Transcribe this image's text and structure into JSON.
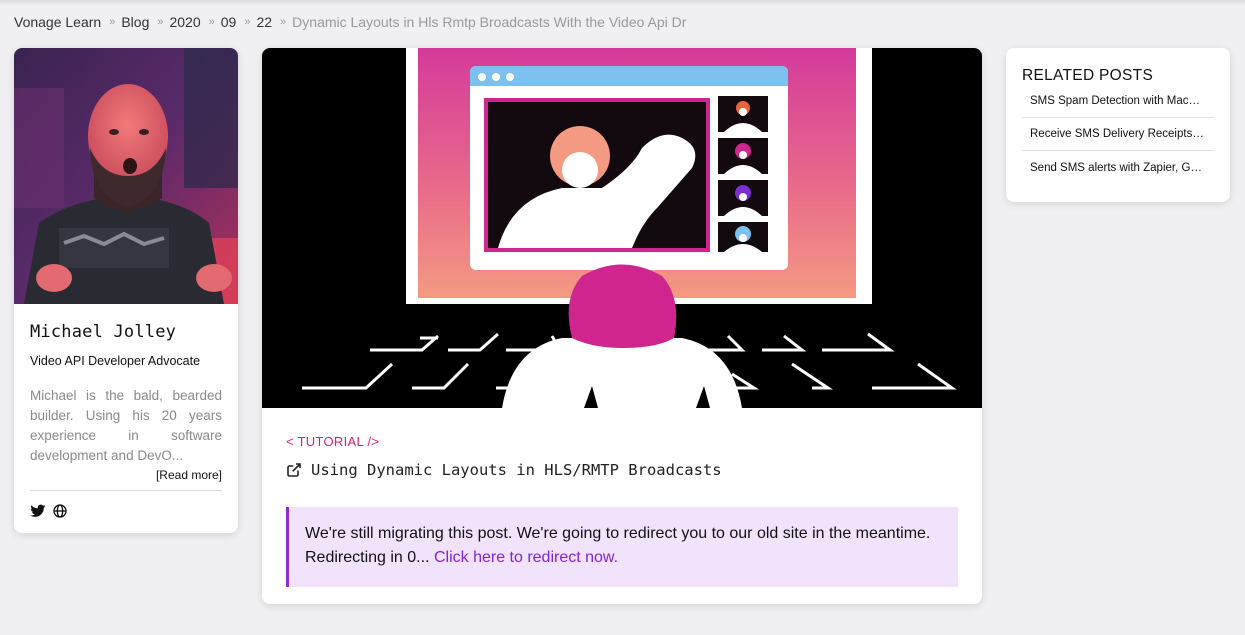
{
  "breadcrumb": {
    "items": [
      "Vonage Learn",
      "Blog",
      "2020",
      "09",
      "22"
    ],
    "separator": "»",
    "current": "Dynamic Layouts in Hls Rmtp Broadcasts With the Video Api Dr"
  },
  "author": {
    "name": "Michael Jolley",
    "role": "Video API Developer Advocate",
    "bio": "Michael is the bald, bearded builder. Using his 20 years experience in software development and DevO...",
    "read_more": "[Read more]",
    "social_icons": [
      "twitter-icon",
      "globe-icon"
    ]
  },
  "post": {
    "tag": "< TUTORIAL />",
    "title": "Using Dynamic Layouts in HLS/RMTP Broadcasts",
    "title_icon": "external-link-icon",
    "notice_text": "We're still migrating this post. We're going to redirect you to our old site in the meantime. Redirecting in 0... ",
    "notice_link": "Click here to redirect now."
  },
  "related": {
    "heading": "RELATED POSTS",
    "items": [
      "SMS Spam Detection with Machine Learning in Python",
      "Receive SMS Delivery Receipts with Node.js",
      "Send SMS alerts with Zapier, Google Sheets and Vonage"
    ]
  },
  "colors": {
    "accent_pink": "#d6217a",
    "accent_purple": "#8124d9",
    "notice_bg": "#f1e3fb"
  }
}
